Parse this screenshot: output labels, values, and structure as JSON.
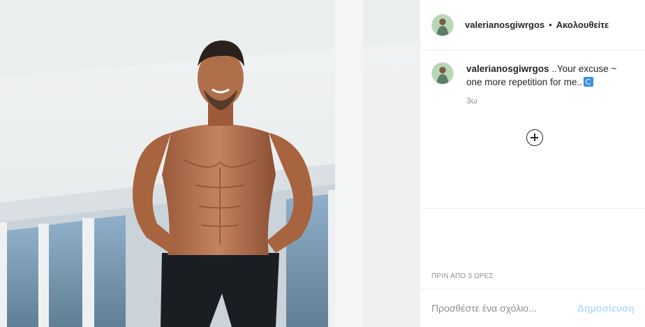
{
  "header": {
    "username": "valerianosgiwrgos",
    "separator": "•",
    "follow_status": "Ακολουθείτε"
  },
  "caption": {
    "username": "valerianosgiwrgos",
    "text": "..Your excuse ~ one more repetition for me..",
    "emoji": "repeat-emoji",
    "time": "3ω"
  },
  "load_more": {
    "icon": "plus-circle-icon"
  },
  "meta": {
    "posted_ago": "ΠΡΙΝ ΑΠΟ 3 ΩΡΕΣ"
  },
  "comment_form": {
    "placeholder": "Προσθέστε ένα σχόλιο...",
    "post_label": "Δημοσίευση"
  },
  "colors": {
    "border": "#efefef",
    "text": "#262626",
    "muted": "#8e8e8e",
    "post_disabled": "#b2dffc"
  }
}
